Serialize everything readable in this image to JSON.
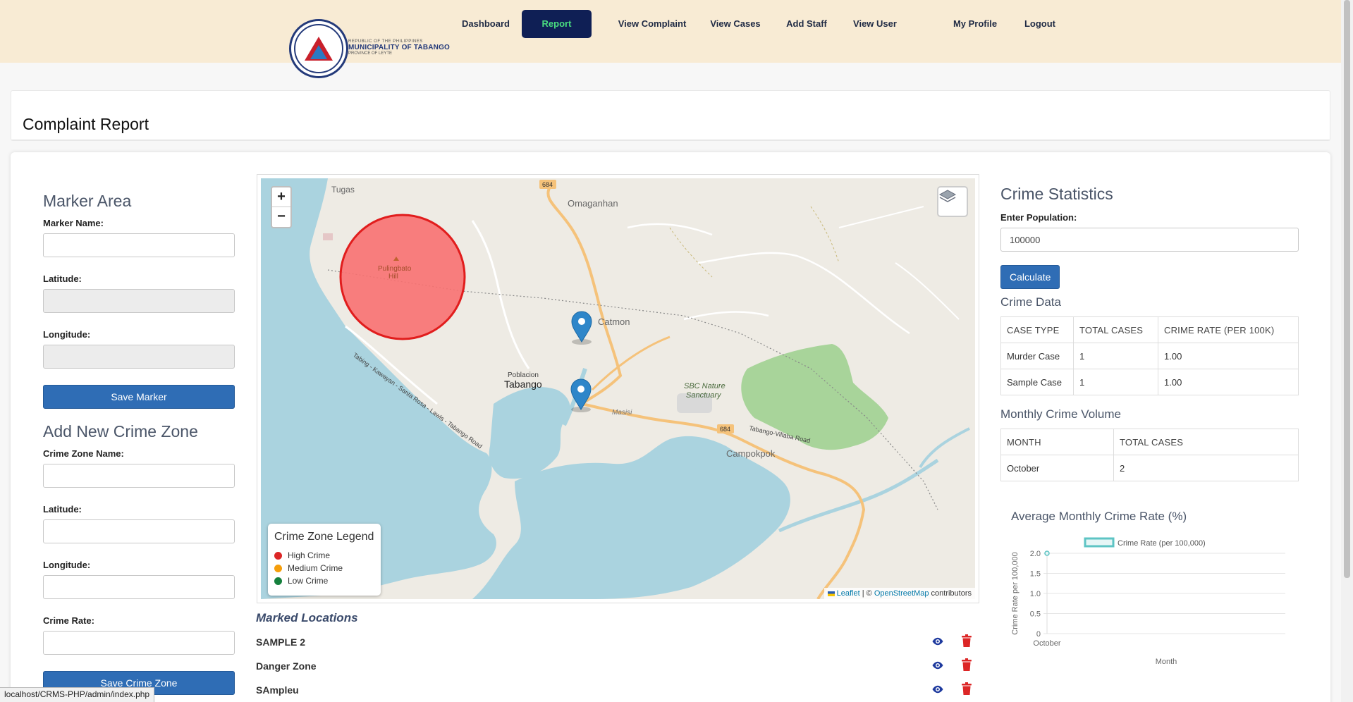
{
  "nav": {
    "items": [
      {
        "label": "Dashboard"
      },
      {
        "label": "Report"
      },
      {
        "label": "View Complaint"
      },
      {
        "label": "View Cases"
      },
      {
        "label": "Add Staff"
      },
      {
        "label": "View User"
      },
      {
        "label": "My Profile"
      },
      {
        "label": "Logout"
      }
    ],
    "active": "Report",
    "active_text_color": "#4ade80",
    "active_bg_color": "#0f1f55"
  },
  "logo": {
    "seal_text": "MUNICIPALITY OF TABANGO",
    "line1": "REPUBLIC OF THE PHILIPPINES",
    "line2": "MUNICIPALITY OF TABANGO",
    "line3": "PROVINCE OF LEYTE"
  },
  "page": {
    "title": "Complaint Report"
  },
  "marker_area": {
    "heading": "Marker Area",
    "name_label": "Marker Name:",
    "lat_label": "Latitude:",
    "lng_label": "Longitude:",
    "save_label": "Save Marker"
  },
  "crime_zone": {
    "heading": "Add New Crime Zone",
    "name_label": "Crime Zone Name:",
    "lat_label": "Latitude:",
    "lng_label": "Longitude:",
    "rate_label": "Crime Rate:",
    "save_label": "Save Crime Zone"
  },
  "map": {
    "zoom_in": "+",
    "zoom_out": "−",
    "place_labels": {
      "tugas": "Tugas",
      "omaganhan": "Omaganhan",
      "catmon": "Catmon",
      "poblacion": "Poblacion",
      "tabango": "Tabango",
      "campokpok": "Campokpok",
      "masisi": "Masisi",
      "sbc1": "SBC Nature",
      "sbc2": "Sanctuary",
      "hill1": "Pulingbato",
      "hill2": "Hill",
      "road_684a": "684",
      "road_684b": "684",
      "coastal_road": "Tabing - Kawayan - Santa Rosa - Lawis - Tabango Road",
      "villaba_road": "Tabango-Villaba Road"
    },
    "legend": {
      "title": "Crime Zone Legend",
      "items": [
        {
          "label": "High Crime",
          "color": "#dc2626"
        },
        {
          "label": "Medium Crime",
          "color": "#f59e0b"
        },
        {
          "label": "Low Crime",
          "color": "#15803d"
        }
      ]
    },
    "attribution": {
      "leaflet": "Leaflet",
      "sep": " | © ",
      "osm": "OpenStreetMap",
      "tail": " contributors"
    }
  },
  "marked_locations": {
    "heading": "Marked Locations",
    "items": [
      {
        "name": "SAMPLE 2"
      },
      {
        "name": "Danger Zone"
      },
      {
        "name": "SAmpleu"
      }
    ]
  },
  "stats": {
    "heading": "Crime Statistics",
    "pop_label": "Enter Population:",
    "pop_value": "100000",
    "calc_label": "Calculate",
    "crime_data_heading": "Crime Data",
    "crime_table": {
      "headers": [
        "CASE TYPE",
        "TOTAL CASES",
        "CRIME RATE (PER 100K)"
      ],
      "rows": [
        [
          "Murder Case",
          "1",
          "1.00"
        ],
        [
          "Sample Case",
          "1",
          "1.00"
        ]
      ]
    },
    "monthly_heading": "Monthly Crime Volume",
    "monthly_table": {
      "headers": [
        "MONTH",
        "TOTAL CASES"
      ],
      "rows": [
        [
          "October",
          "2"
        ]
      ]
    }
  },
  "chart_data": {
    "type": "line",
    "title": "Average Monthly Crime Rate (%)",
    "categories": [
      "October"
    ],
    "series": [
      {
        "name": "Crime Rate (per 100,000)",
        "values": [
          2.0
        ],
        "color": "#5ec4c4"
      }
    ],
    "xlabel": "Month",
    "ylabel": "Crime Rate per 100,000",
    "ylim": [
      0,
      2.0
    ],
    "yticks": [
      "0",
      "0.5",
      "1.0",
      "1.5",
      "2.0"
    ],
    "grid": true,
    "legend": "top"
  },
  "statusbar": {
    "url": "localhost/CRMS-PHP/admin/index.php"
  }
}
